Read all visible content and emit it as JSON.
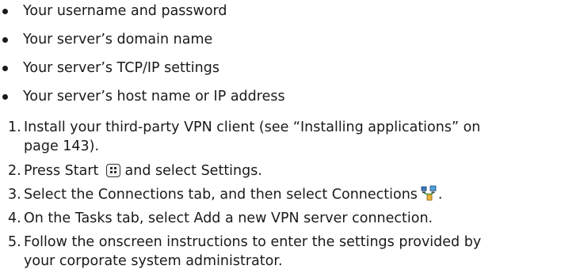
{
  "bullets": [
    "Your username and password",
    "Your server’s domain name",
    "Your server’s TCP/IP settings",
    "Your server’s host name or IP address"
  ],
  "steps": [
    {
      "number": "1.",
      "line1": "Install your third-party VPN client (see “Installing applications” on",
      "line2": "page 143)."
    },
    {
      "number": "2.",
      "line1": "Press Start",
      "line1_after": "and select Settings."
    },
    {
      "number": "3.",
      "line1": "Select the Connections tab, and then select Connections",
      "line1_after": "."
    },
    {
      "number": "4.",
      "line1": "On the Tasks tab, select Add a new VPN server connection."
    },
    {
      "number": "5.",
      "line1": "Follow the onscreen instructions to enter the settings provided by",
      "line2": "your corporate system administrator."
    }
  ],
  "icons": {
    "start": "windows-start-icon",
    "connections": "connections-icon"
  }
}
